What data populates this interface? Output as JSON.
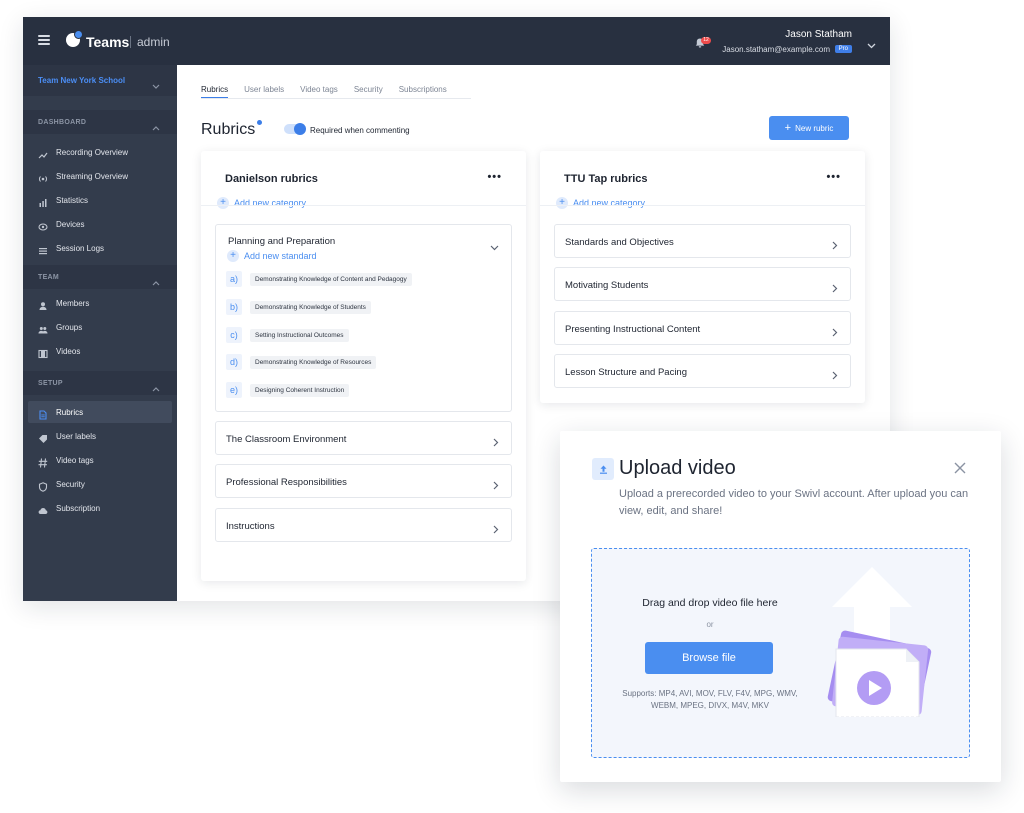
{
  "header": {
    "brand": "Teams",
    "role": "admin",
    "notification_count": "12",
    "user_name": "Jason Statham",
    "user_email": "Jason.statham@example.com",
    "plan_badge": "Pro"
  },
  "sidebar": {
    "team_name": "Team New York School",
    "sections": [
      {
        "title": "DASHBOARD",
        "items": [
          {
            "label": "Recording Overview",
            "icon": "line-chart-icon"
          },
          {
            "label": "Streaming Overview",
            "icon": "broadcast-icon"
          },
          {
            "label": "Statistics",
            "icon": "bar-chart-icon"
          },
          {
            "label": "Devices",
            "icon": "device-icon"
          },
          {
            "label": "Session Logs",
            "icon": "list-icon"
          }
        ]
      },
      {
        "title": "TEAM",
        "items": [
          {
            "label": "Members",
            "icon": "user-icon"
          },
          {
            "label": "Groups",
            "icon": "group-icon"
          },
          {
            "label": "Videos",
            "icon": "film-icon"
          }
        ]
      },
      {
        "title": "SETUP",
        "items": [
          {
            "label": "Rubrics",
            "icon": "document-icon",
            "active": true
          },
          {
            "label": "User labels",
            "icon": "label-icon"
          },
          {
            "label": "Video tags",
            "icon": "hash-icon"
          },
          {
            "label": "Security",
            "icon": "shield-icon"
          },
          {
            "label": "Subscription",
            "icon": "cloud-icon"
          }
        ]
      }
    ]
  },
  "tabs": [
    "Rubrics",
    "User labels",
    "Video tags",
    "Security",
    "Subscriptions"
  ],
  "active_tab": "Rubrics",
  "page": {
    "title": "Rubrics",
    "toggle_label": "Required when commenting",
    "toggle_on": true,
    "new_rubric_label": "New rubric"
  },
  "rubric_cards": [
    {
      "title": "Danielson rubrics",
      "add_category_label": "Add new category",
      "expanded_category": {
        "title": "Planning and Preparation",
        "add_standard_label": "Add new standard",
        "standards": [
          {
            "letter": "a)",
            "text": "Demonstrating Knowledge of Content and Pedagogy"
          },
          {
            "letter": "b)",
            "text": "Demonstrating Knowledge of Students"
          },
          {
            "letter": "c)",
            "text": "Setting Instructional Outcomes"
          },
          {
            "letter": "d)",
            "text": "Demonstrating Knowledge of Resources"
          },
          {
            "letter": "e)",
            "text": "Designing Coherent Instruction"
          }
        ]
      },
      "categories": [
        "The Classroom Environment",
        "Professional Responsibilities",
        "Instructions"
      ]
    },
    {
      "title": "TTU Tap rubrics",
      "add_category_label": "Add new category",
      "categories": [
        "Standards and Objectives",
        "Motivating Students",
        "Presenting Instructional Content",
        "Lesson Structure and Pacing"
      ]
    }
  ],
  "upload_modal": {
    "title": "Upload video",
    "description": "Upload a prerecorded video to your Swivl account. After upload you can view, edit, and share!",
    "drop_title": "Drag and drop video file here",
    "or_text": "or",
    "browse_label": "Browse file",
    "supports_text": "Supports: MP4, AVI, MOV, FLV, F4V, MPG, WMV, WEBM, MPEG, DIVX, M4V, MKV"
  },
  "colors": {
    "accent": "#4a8ef0",
    "topbar": "#283040",
    "sidebar": "#333c4c",
    "team_name": "#4b8ef5",
    "notification_badge": "#ee4b4b"
  }
}
